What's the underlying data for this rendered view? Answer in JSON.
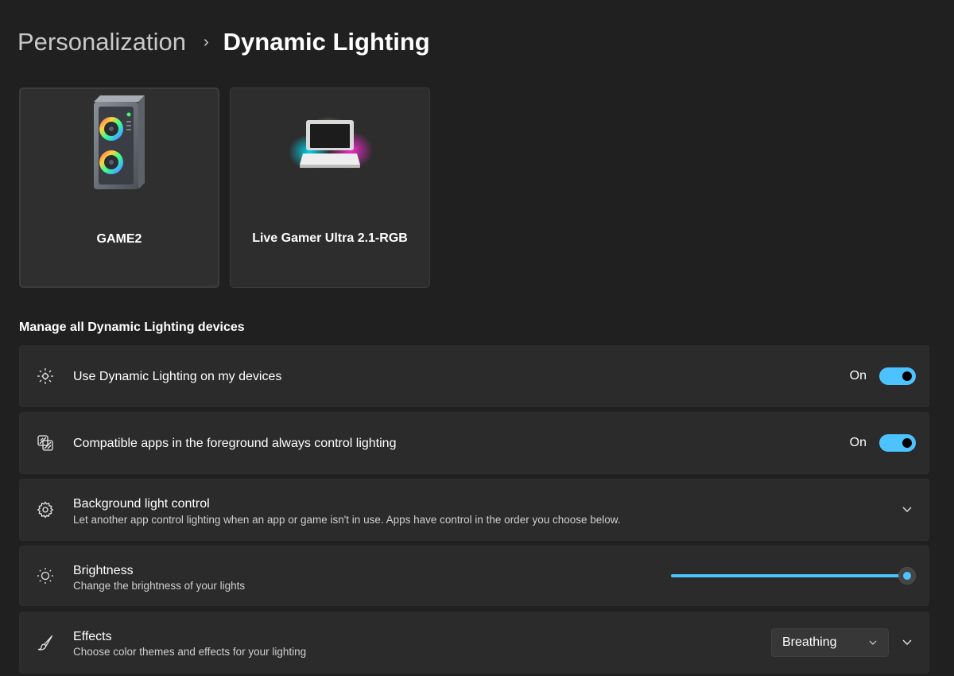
{
  "breadcrumb": {
    "parent": "Personalization",
    "separator": "›",
    "current": "Dynamic Lighting"
  },
  "devices": [
    {
      "name": "GAME2",
      "icon": "pc-tower-rgb-icon"
    },
    {
      "name": "Live Gamer Ultra 2.1-RGB",
      "icon": "capture-device-rgb-icon"
    }
  ],
  "section_heading": "Manage all Dynamic Lighting devices",
  "settings": {
    "use_dynamic_lighting": {
      "title": "Use Dynamic Lighting on my devices",
      "state_label": "On",
      "enabled": true,
      "icon": "dynamic-lighting-icon"
    },
    "compatible_apps": {
      "title": "Compatible apps in the foreground always control lighting",
      "state_label": "On",
      "enabled": true,
      "icon": "apps-lighting-icon"
    },
    "background_light_control": {
      "title": "Background light control",
      "description": "Let another app control lighting when an app or game isn't in use. Apps have control in the order you choose below.",
      "icon": "gear-icon"
    },
    "brightness": {
      "title": "Brightness",
      "description": "Change the brightness of your lights",
      "value": 1.0,
      "icon": "sun-icon"
    },
    "effects": {
      "title": "Effects",
      "description": "Choose color themes and effects for your lighting",
      "selected": "Breathing",
      "icon": "brush-icon"
    }
  },
  "colors": {
    "accent": "#4cc2ff",
    "background": "#202020",
    "card": "#2b2b2b"
  }
}
